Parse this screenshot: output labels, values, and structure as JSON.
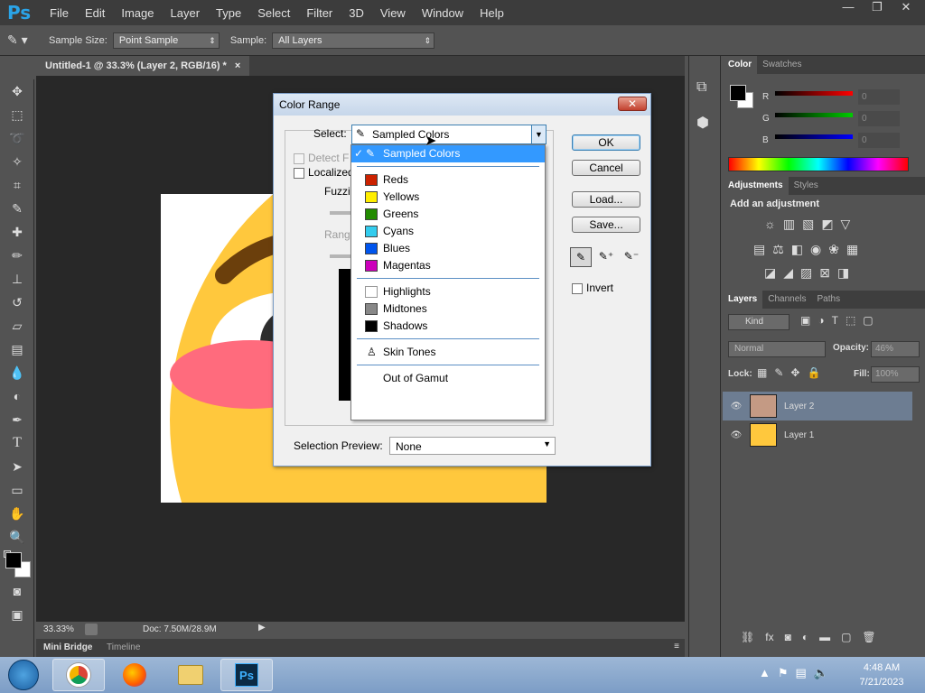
{
  "app": {
    "logo": "Ps"
  },
  "menu": [
    "File",
    "Edit",
    "Image",
    "Layer",
    "Type",
    "Select",
    "Filter",
    "3D",
    "View",
    "Window",
    "Help"
  ],
  "window_controls": [
    "—",
    "❐",
    "✕"
  ],
  "options": {
    "sample_size_label": "Sample Size:",
    "sample_size_value": "Point Sample",
    "sample_label": "Sample:",
    "sample_value": "All Layers"
  },
  "document": {
    "tab_title": "Untitled-1 @ 33.3% (Layer 2, RGB/16) *",
    "tab_close": "×",
    "zoom": "33.33%",
    "doc_info": "Doc: 7.50M/28.9M"
  },
  "bottom_tabs": [
    "Mini Bridge",
    "Timeline"
  ],
  "color_panel": {
    "tabs": [
      "Color",
      "Swatches"
    ],
    "channels": [
      {
        "label": "R",
        "value": "0"
      },
      {
        "label": "G",
        "value": "0"
      },
      {
        "label": "B",
        "value": "0"
      }
    ]
  },
  "adjustments_panel": {
    "tabs": [
      "Adjustments",
      "Styles"
    ],
    "heading": "Add an adjustment"
  },
  "layers_panel": {
    "tabs": [
      "Layers",
      "Channels",
      "Paths"
    ],
    "filter_kind": "Kind",
    "blend_mode": "Normal",
    "opacity_label": "Opacity:",
    "opacity_value": "46%",
    "lock_label": "Lock:",
    "fill_label": "Fill:",
    "fill_value": "100%",
    "layers": [
      {
        "name": "Layer 2",
        "selected": true
      },
      {
        "name": "Layer 1",
        "selected": false
      }
    ]
  },
  "dialog": {
    "title": "Color Range",
    "close": "✕",
    "select_label": "Select:",
    "select_value": "Sampled Colors",
    "detect_faces": "Detect F",
    "localized": "Localized",
    "fuzziness": "Fuzzir",
    "range": "Range",
    "buttons": {
      "ok": "OK",
      "cancel": "Cancel",
      "load": "Load...",
      "save": "Save..."
    },
    "invert": "Invert",
    "preview_label": "Selection Preview:",
    "preview_value": "None",
    "dropdown": {
      "selected": "Sampled Colors",
      "colors": [
        {
          "label": "Reds",
          "color": "#cc2200"
        },
        {
          "label": "Yellows",
          "color": "#ffee00"
        },
        {
          "label": "Greens",
          "color": "#228b00"
        },
        {
          "label": "Cyans",
          "color": "#33ccee"
        },
        {
          "label": "Blues",
          "color": "#0055ee"
        },
        {
          "label": "Magentas",
          "color": "#cc00bb"
        }
      ],
      "tones": [
        {
          "label": "Highlights",
          "color": "#ffffff"
        },
        {
          "label": "Midtones",
          "color": "#888888"
        },
        {
          "label": "Shadows",
          "color": "#000000"
        }
      ],
      "skin": "Skin Tones",
      "gamut": "Out of Gamut"
    }
  },
  "taskbar": {
    "time": "4:48 AM",
    "date": "7/21/2023"
  },
  "colors": {
    "accent": "#3399ff",
    "canvas_bg": "#282828",
    "panel": "#535353"
  }
}
